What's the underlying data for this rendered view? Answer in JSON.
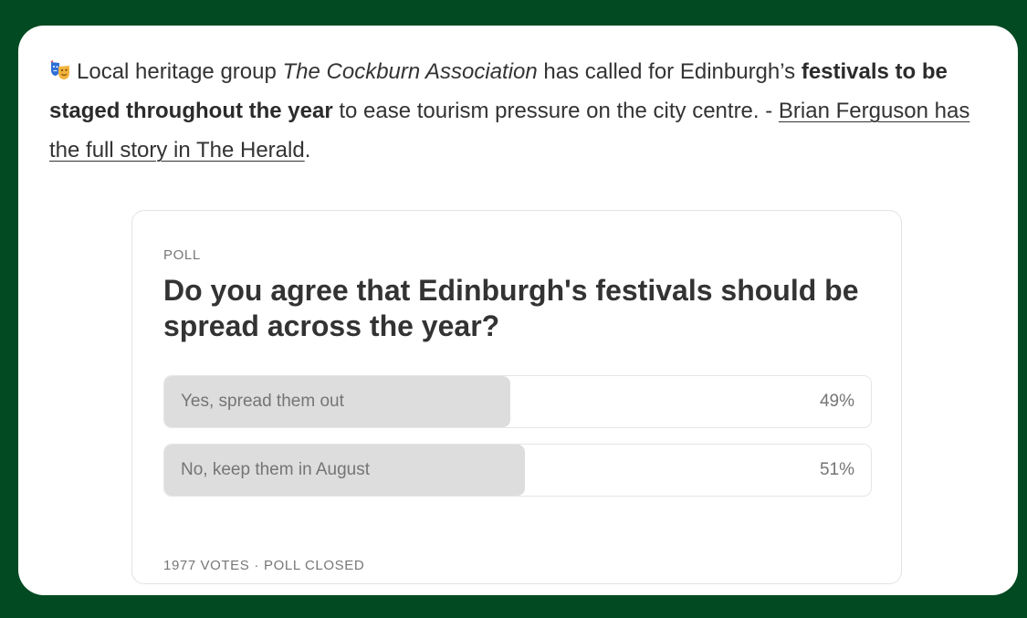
{
  "intro": {
    "emoji_icon": "performing-arts-masks-icon",
    "text_before": "Local heritage group ",
    "org_name": "The Cockburn Association",
    "text_middle": " has called for Edinburgh’s ",
    "bold_text": "festivals to be staged throughout the year",
    "text_after": " to ease tourism pressure on the city centre. - ",
    "link_text": "Brian Ferguson has the full story in The Herald",
    "text_end": "."
  },
  "poll": {
    "label": "POLL",
    "question": "Do you agree that Edinburgh's festivals should be spread across the year?",
    "options": [
      {
        "label": "Yes, spread them out",
        "percent_text": "49%",
        "fraction": 0.49
      },
      {
        "label": "No, keep them in August",
        "percent_text": "51%",
        "fraction": 0.51
      }
    ],
    "votes": "1977 VOTES",
    "separator": "·",
    "status": "POLL CLOSED"
  },
  "colors": {
    "background": "#024a22",
    "card": "#ffffff",
    "bar_fill": "#dddddd"
  }
}
